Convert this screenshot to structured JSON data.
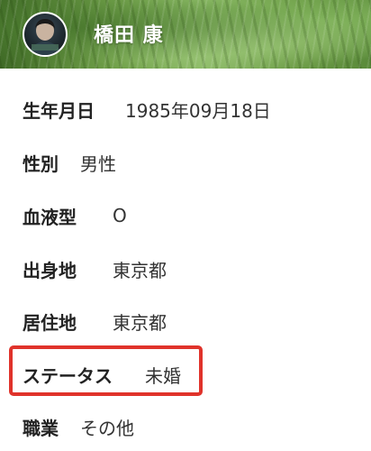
{
  "header": {
    "username": "橋田 康"
  },
  "profile": {
    "rows": [
      {
        "label": "生年月日",
        "value": "1985年09月18日"
      },
      {
        "label": "性別",
        "value": "男性"
      },
      {
        "label": "血液型",
        "value": "O"
      },
      {
        "label": "出身地",
        "value": "東京都"
      },
      {
        "label": "居住地",
        "value": "東京都"
      },
      {
        "label": "ステータス",
        "value": "未婚"
      },
      {
        "label": "職業",
        "value": "その他"
      }
    ]
  },
  "colors": {
    "highlight_border": "#e0332b",
    "header_green": "#6f9f48",
    "text": "#222222"
  }
}
